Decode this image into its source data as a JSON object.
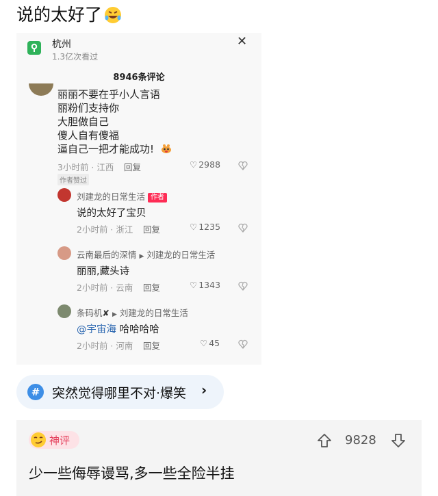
{
  "post": {
    "title": "说的太好了"
  },
  "location": {
    "city": "杭州",
    "views": "1.3亿次看过",
    "close_glyph": "✕"
  },
  "comments_header": {
    "count_label": "8946条评论"
  },
  "main_comment": {
    "lines": [
      "丽丽不要在乎小人言语",
      "丽粉们支持你",
      "大胆做自己",
      "傻人自有傻福",
      "逼自己一把才能成功!"
    ],
    "meta": "3小时前 · 江西",
    "reply_label": "回复",
    "likes": "2988",
    "author_liked": "作者赞过"
  },
  "replies": [
    {
      "user": "刘建龙的日常生活",
      "tag": "作者",
      "text": "说的太好了宝贝",
      "meta": "2小时前 · 浙江",
      "reply_label": "回复",
      "likes": "1235"
    },
    {
      "user": "云南最后的深情",
      "arrow": "▶",
      "target": "刘建龙的日常生活",
      "text": "丽丽,藏头诗",
      "meta": "2小时前 · 云南",
      "reply_label": "回复",
      "likes": "1343"
    },
    {
      "user": "条码机",
      "mark": "✘",
      "arrow": "▶",
      "target": "刘建龙的日常生活",
      "mention": "@宇宙海",
      "text": " 哈哈哈哈",
      "meta": "2小时前 · 河南",
      "reply_label": "回复",
      "likes": "45"
    }
  ],
  "topic": {
    "hash": "#",
    "label": "突然觉得哪里不对·爆笑",
    "chevron": "›"
  },
  "hot_comment": {
    "badge": "神评",
    "votes": "9828",
    "text": "少一些侮辱谩骂,多一些全险半挂"
  },
  "colors": {
    "author_tag": "#fe2c55",
    "mention": "#2a66b0",
    "topic_icon": "#3d8ee6",
    "hot_badge_text": "#e4405c"
  }
}
